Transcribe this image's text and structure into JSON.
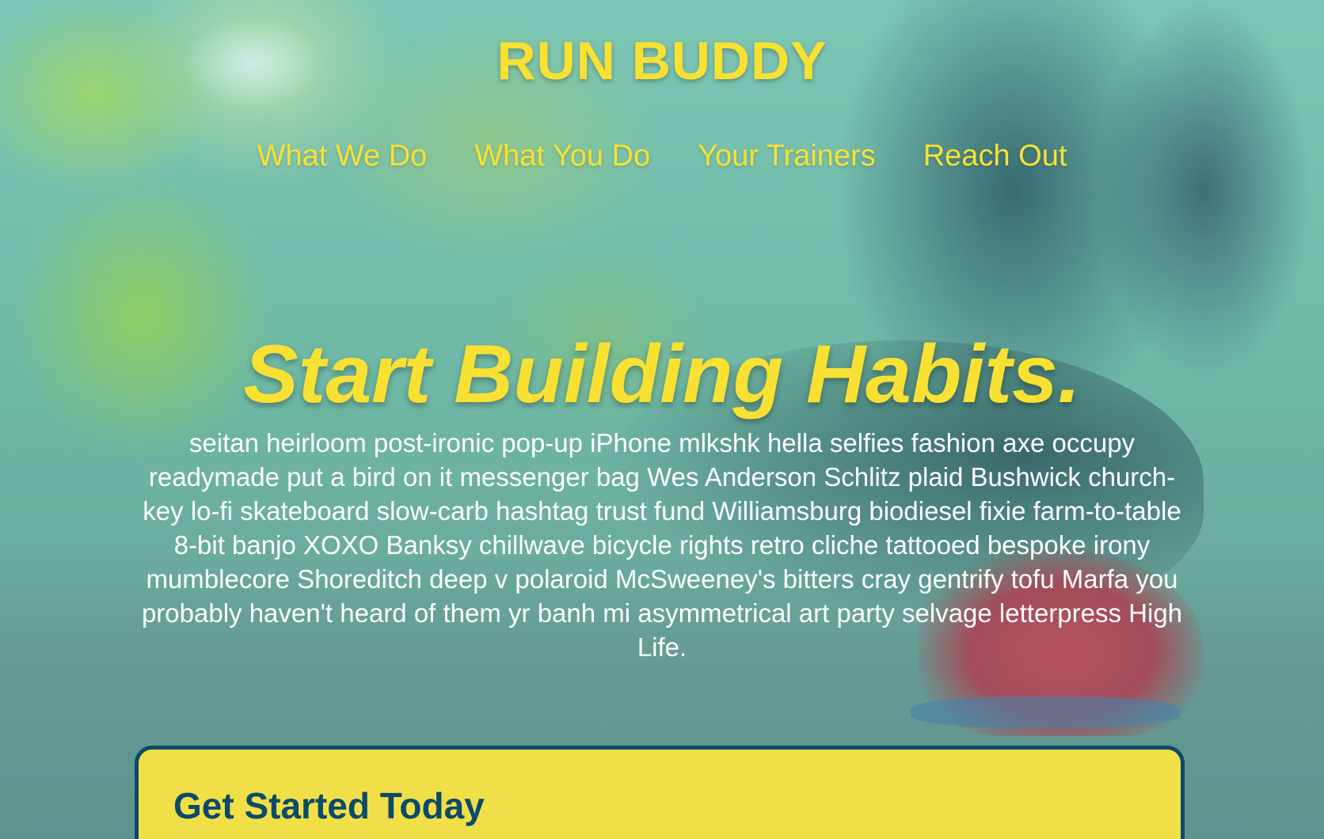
{
  "header": {
    "title": "RUN BUDDY",
    "nav": [
      {
        "label": "What We Do"
      },
      {
        "label": "What You Do"
      },
      {
        "label": "Your Trainers"
      },
      {
        "label": "Reach Out"
      }
    ]
  },
  "hero": {
    "headline": "Start Building Habits.",
    "body": "seitan heirloom post-ironic pop-up iPhone mlkshk hella selfies fashion axe occupy readymade put a bird on it messenger bag Wes Anderson Schlitz plaid Bushwick church-key lo-fi skateboard slow-carb hashtag trust fund Williamsburg biodiesel fixie farm-to-table 8-bit banjo XOXO Banksy chillwave bicycle rights retro cliche tattooed bespoke irony mumblecore Shoreditch deep v polaroid McSweeney's bitters cray gentrify tofu Marfa you probably haven't heard of them yr banh mi asymmetrical art party selvage letterpress High Life."
  },
  "signup_card": {
    "title": "Get Started Today"
  },
  "colors": {
    "accent": "#f8e133",
    "card_border": "#0c4a6a",
    "card_bg": "#f0df47"
  }
}
